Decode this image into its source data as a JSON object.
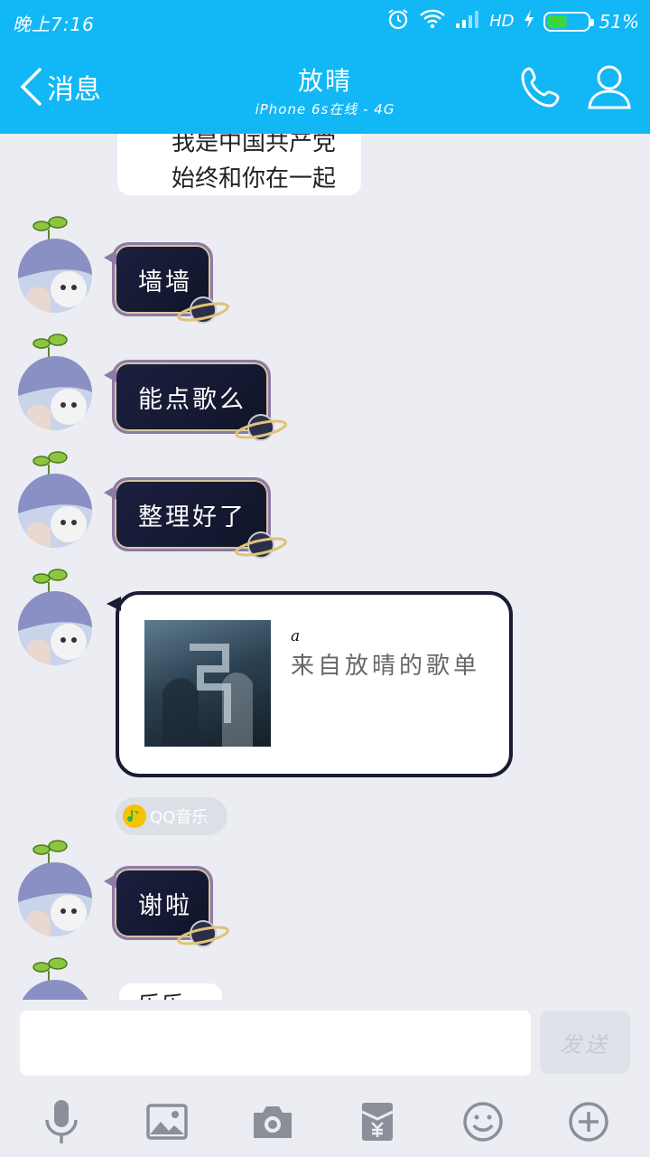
{
  "status_bar": {
    "time": "晚上7:16",
    "network": "HD",
    "battery_percent": "51%",
    "battery_level": 0.51
  },
  "header": {
    "back_label": "消息",
    "title": "放晴",
    "subtitle": "iPhone 6s在线 - 4G",
    "icons": [
      "phone-icon",
      "profile-icon"
    ]
  },
  "messages": {
    "partial_top_text": "我是中国共产党\n始终和你在一起",
    "items": [
      {
        "text": "墙墙"
      },
      {
        "text": "能点歌么"
      },
      {
        "text": "整理好了"
      }
    ],
    "music_card": {
      "title": "a",
      "subtitle": "来自放晴的歌单"
    },
    "music_source": "QQ音乐",
    "last": {
      "text": "谢啦"
    },
    "partial_bottom_text": "乐乐"
  },
  "input": {
    "value": "",
    "placeholder": "",
    "send_label": "发送"
  },
  "toolbar": {
    "icons": [
      "microphone-icon",
      "image-icon",
      "camera-icon",
      "red-packet-icon",
      "emoji-icon",
      "plus-icon"
    ]
  },
  "colors": {
    "header": "#12b7f5",
    "background": "#ebedf2",
    "bubble_dark": "#1c2040"
  }
}
